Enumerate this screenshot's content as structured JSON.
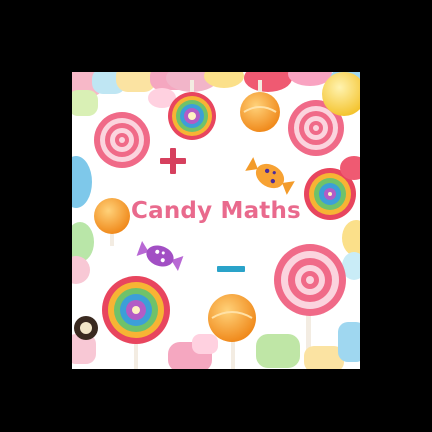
{
  "app": {
    "title": "Candy Maths",
    "title_color": "#e96a8d",
    "background_color": "#000000",
    "card_color": "#ffffff"
  },
  "symbols": {
    "plus": "+",
    "minus": "-",
    "plus_color": "#d6405e",
    "minus_color": "#2aa3c9"
  },
  "decorations": [
    "pink-swirl-lollipop-icon",
    "rainbow-swirl-lollipop-icon",
    "orange-lollipop-icon",
    "wrapped-orange-candy-icon",
    "wrapped-purple-candy-icon",
    "marshmallow-icon",
    "gummy-candy-icon"
  ]
}
